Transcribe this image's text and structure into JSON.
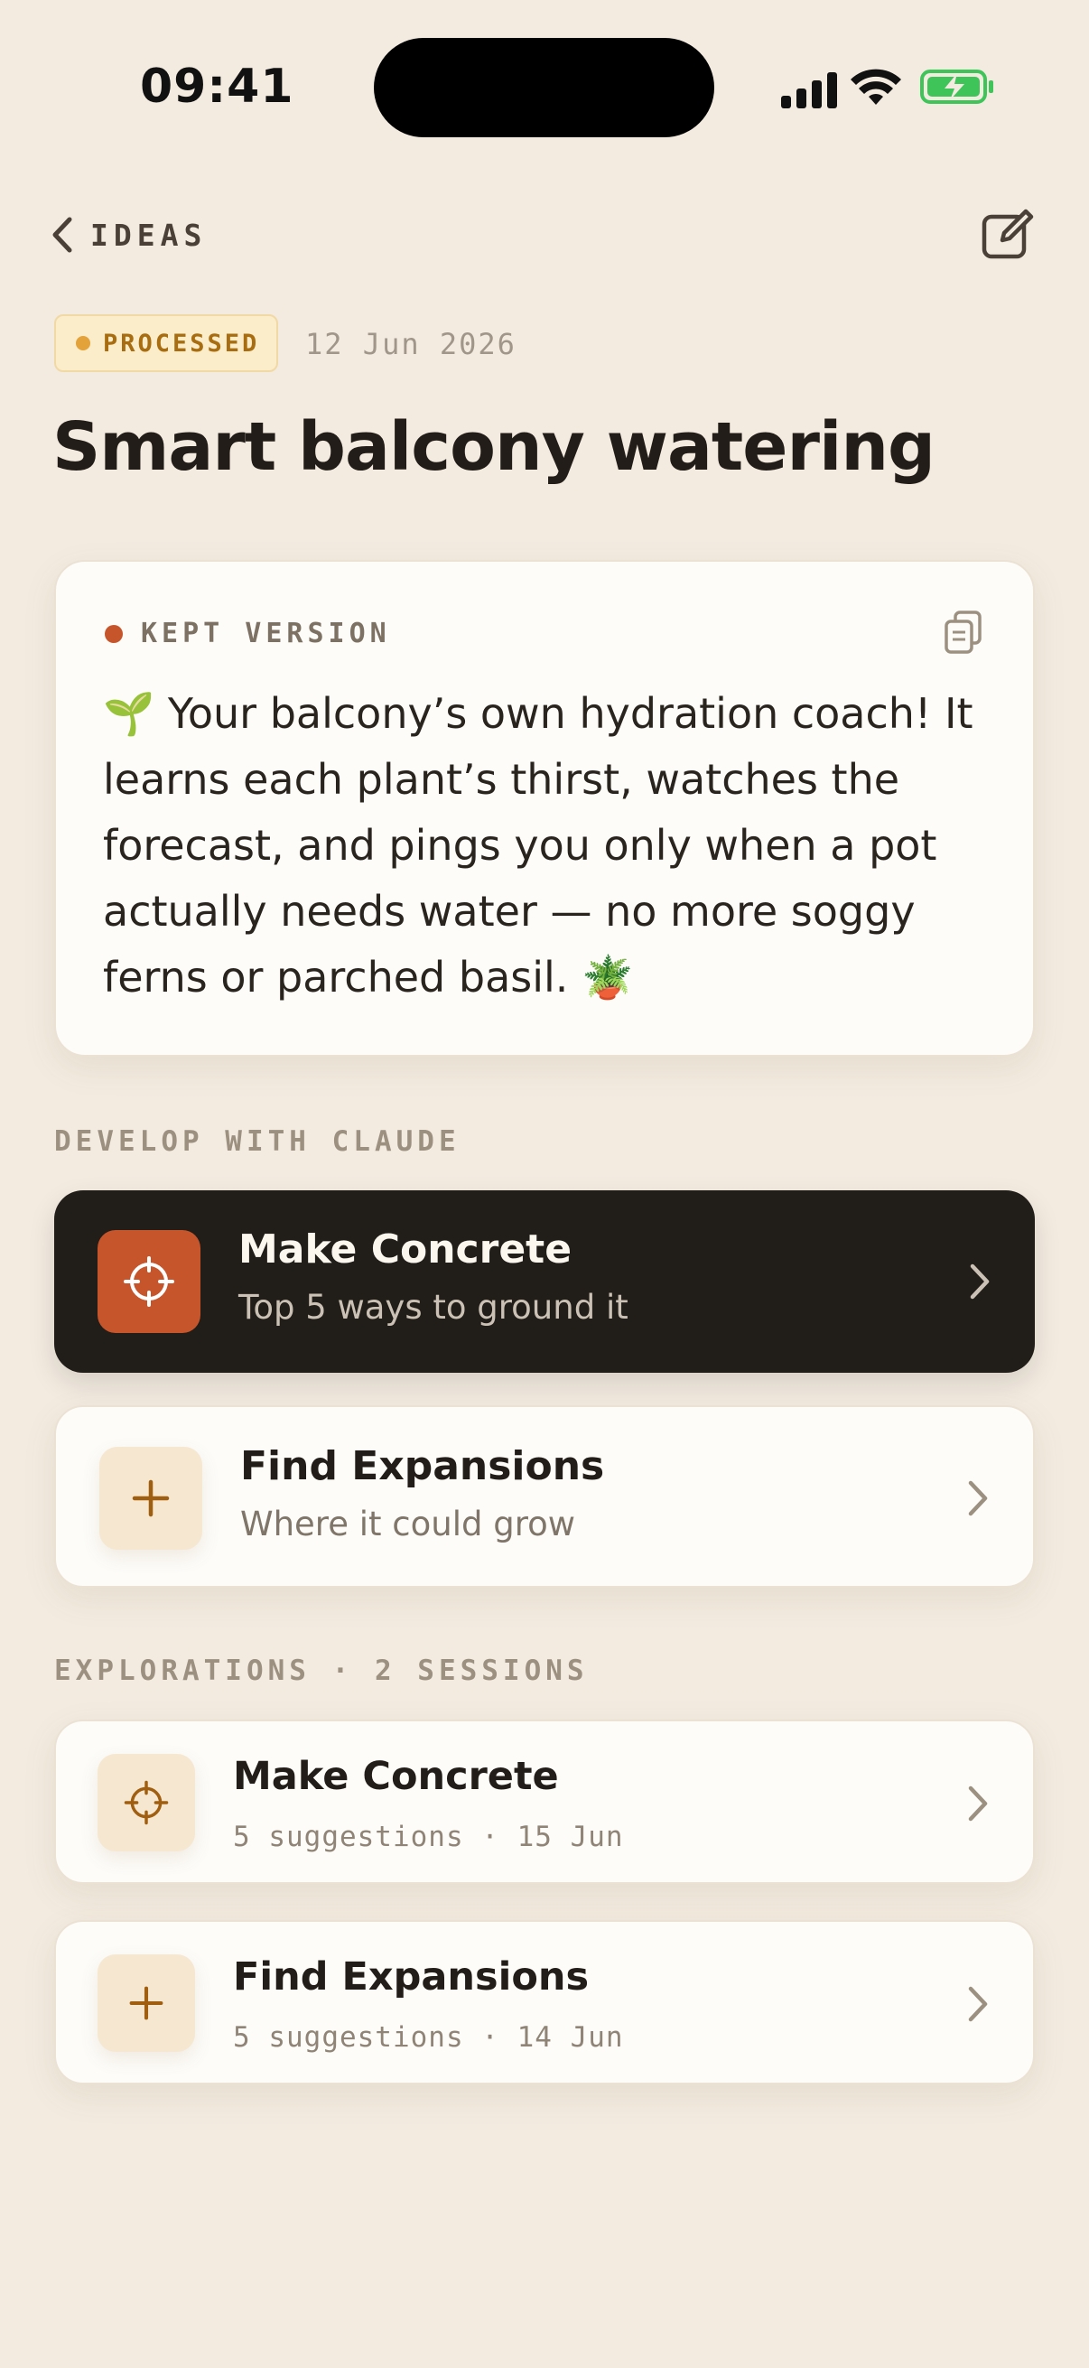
{
  "status_bar": {
    "time": "09:41"
  },
  "nav": {
    "back_label": "IDEAS"
  },
  "meta": {
    "status": "PROCESSED",
    "date": "12 Jun 2026"
  },
  "title": "Smart balcony watering",
  "kept": {
    "label": "KEPT VERSION",
    "text": "🌱 Your balcony’s own hydration coach! It learns each plant’s thirst, watches the forecast, and pings you only when a pot actually needs water — no more soggy ferns or parched basil. 🪴"
  },
  "develop": {
    "label": "DEVELOP WITH CLAUDE",
    "actions": [
      {
        "title": "Make Concrete",
        "subtitle": "Top 5 ways to ground it",
        "icon": "crosshair-icon"
      },
      {
        "title": "Find Expansions",
        "subtitle": "Where it could grow",
        "icon": "plus-icon"
      }
    ]
  },
  "explorations": {
    "label": "EXPLORATIONS · 2 SESSIONS",
    "sessions": [
      {
        "title": "Make Concrete",
        "meta": "5 suggestions · 15 Jun",
        "icon": "crosshair-icon"
      },
      {
        "title": "Find Expansions",
        "meta": "5 suggestions · 14 Jun",
        "icon": "plus-icon"
      }
    ]
  },
  "colors": {
    "background": "#f3ebe0",
    "accent": "#c6552c",
    "dark_card": "#211d19",
    "pill_bg": "#fbecca",
    "pill_text": "#a86d10",
    "battery": "#3fc45a"
  }
}
